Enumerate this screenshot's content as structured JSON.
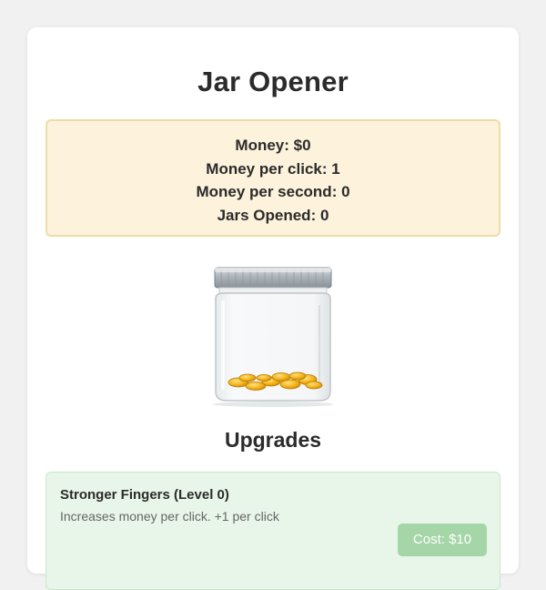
{
  "game": {
    "title": "Jar Opener"
  },
  "stats": {
    "money": "Money: $0",
    "per_click": "Money per click: 1",
    "per_second": "Money per second: 0",
    "jars_opened": "Jars Opened: 0"
  },
  "jar": {
    "icon": "coin-jar-icon"
  },
  "upgrades": {
    "heading": "Upgrades",
    "items": [
      {
        "name": "Stronger Fingers (Level 0)",
        "description": "Increases money per click. +1 per click",
        "cost_label": "Cost: $10"
      }
    ]
  },
  "colors": {
    "stats_bg": "#fdf3dc",
    "stats_border": "#f0dca6",
    "upgrade_bg": "#e8f5e9",
    "cost_button_disabled": "#a5d6a7"
  }
}
